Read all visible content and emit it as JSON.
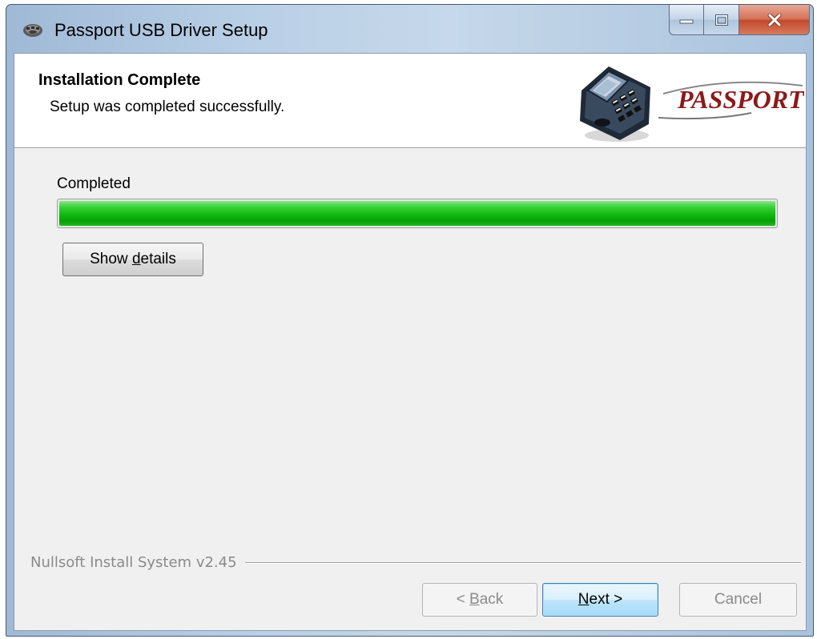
{
  "window": {
    "title": "Passport USB Driver Setup",
    "app_icon": "gear-icon"
  },
  "title_bar_buttons": {
    "minimize_icon": "minimize-icon",
    "maximize_icon": "maximize-icon",
    "close_icon": "close-icon"
  },
  "header": {
    "title": "Installation Complete",
    "subtitle": "Setup was completed successfully.",
    "logo_text": "PASSPORT"
  },
  "progress": {
    "label": "Completed",
    "percent": 100,
    "color": "#11b911"
  },
  "details_button": {
    "label_before": "Show ",
    "mnemonic": "d",
    "label_after": "etails"
  },
  "branding": {
    "text": "Nullsoft Install System v2.45"
  },
  "buttons": {
    "back": {
      "label_before": "< ",
      "mnemonic": "B",
      "label_after": "ack",
      "enabled": false
    },
    "next": {
      "label_before": "",
      "mnemonic": "N",
      "label_after": "ext >",
      "enabled": true
    },
    "cancel": {
      "label": "Cancel",
      "enabled": false
    }
  }
}
